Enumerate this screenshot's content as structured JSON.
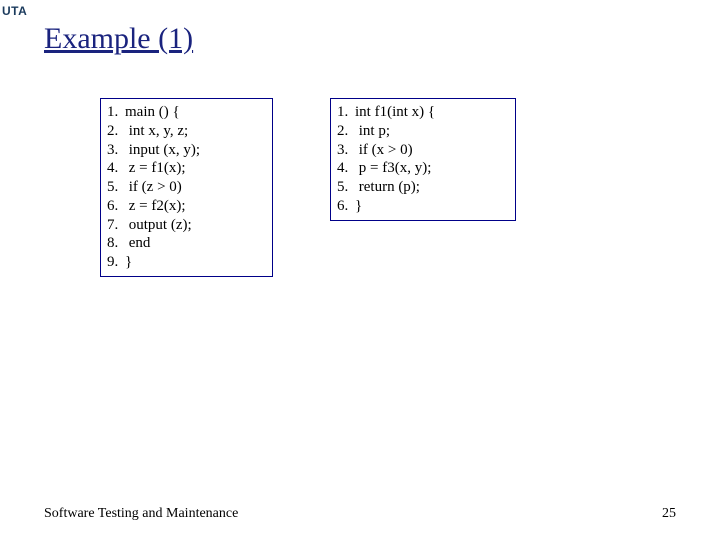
{
  "logo": "UTA",
  "title": "Example (1)",
  "left_code": [
    {
      "n": "1.",
      "t": "main () {"
    },
    {
      "n": "2.",
      "t": " int x, y, z;"
    },
    {
      "n": "3.",
      "t": " input (x, y);"
    },
    {
      "n": "4.",
      "t": " z = f1(x);"
    },
    {
      "n": "5.",
      "t": " if (z > 0)"
    },
    {
      "n": "6.",
      "t": "   z = f2(x);"
    },
    {
      "n": "7.",
      "t": " output (z);"
    },
    {
      "n": "8.",
      "t": " end"
    },
    {
      "n": "9.",
      "t": "}"
    }
  ],
  "right_code": [
    {
      "n": "1.",
      "t": "int f1(int x) {"
    },
    {
      "n": "2.",
      "t": " int p;"
    },
    {
      "n": "3.",
      "t": " if (x > 0)"
    },
    {
      "n": "4.",
      "t": "   p = f3(x, y);"
    },
    {
      "n": "5.",
      "t": " return (p);"
    },
    {
      "n": "6.",
      "t": "}"
    }
  ],
  "footer": {
    "left": "Software Testing and Maintenance",
    "right": "25"
  }
}
